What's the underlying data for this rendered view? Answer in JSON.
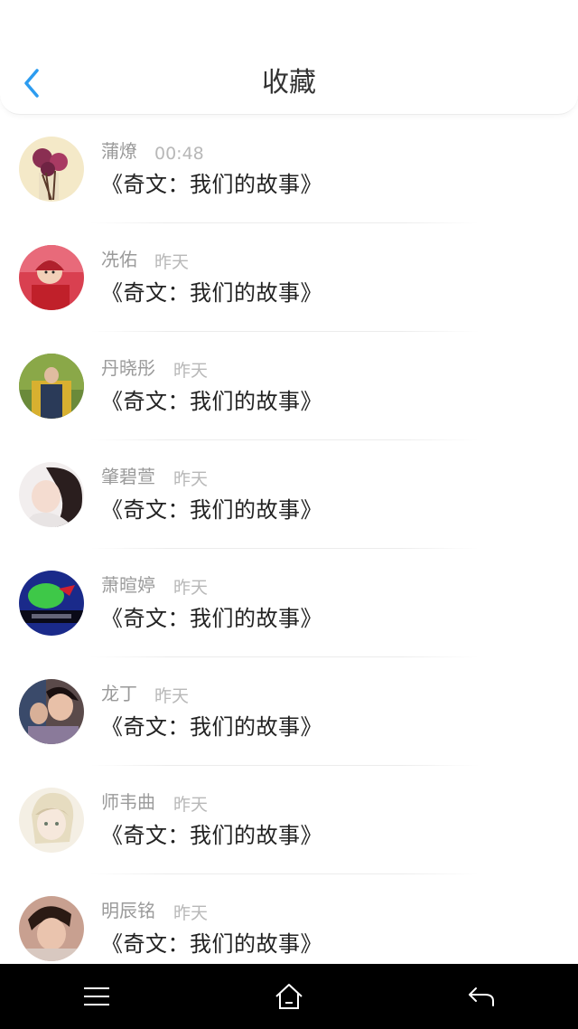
{
  "header": {
    "title": "收藏"
  },
  "colors": {
    "accent": "#2c9cf0"
  },
  "items": [
    {
      "name": "蒲燎",
      "time": "00:48",
      "message": "《奇文：我们的故事》",
      "avatar": "roses-photo"
    },
    {
      "name": "冼佑",
      "time": "昨天",
      "message": "《奇文：我们的故事》",
      "avatar": "child-red-photo"
    },
    {
      "name": "丹晓彤",
      "time": "昨天",
      "message": "《奇文：我们的故事》",
      "avatar": "portrait-photo"
    },
    {
      "name": "肇碧萱",
      "time": "昨天",
      "message": "《奇文：我们的故事》",
      "avatar": "girl-photo"
    },
    {
      "name": "萧暄婷",
      "time": "昨天",
      "message": "《奇文：我们的故事》",
      "avatar": "green-flower-photo"
    },
    {
      "name": "龙丁",
      "time": "昨天",
      "message": "《奇文：我们的故事》",
      "avatar": "couple-photo"
    },
    {
      "name": "师韦曲",
      "time": "昨天",
      "message": "《奇文：我们的故事》",
      "avatar": "anime-photo"
    },
    {
      "name": "明辰铭",
      "time": "昨天",
      "message": "《奇文：我们的故事》",
      "avatar": "boy-photo"
    }
  ],
  "navbar": {
    "menu_icon": "menu-icon",
    "home_icon": "home-icon",
    "back_icon": "back-arrow-icon"
  }
}
